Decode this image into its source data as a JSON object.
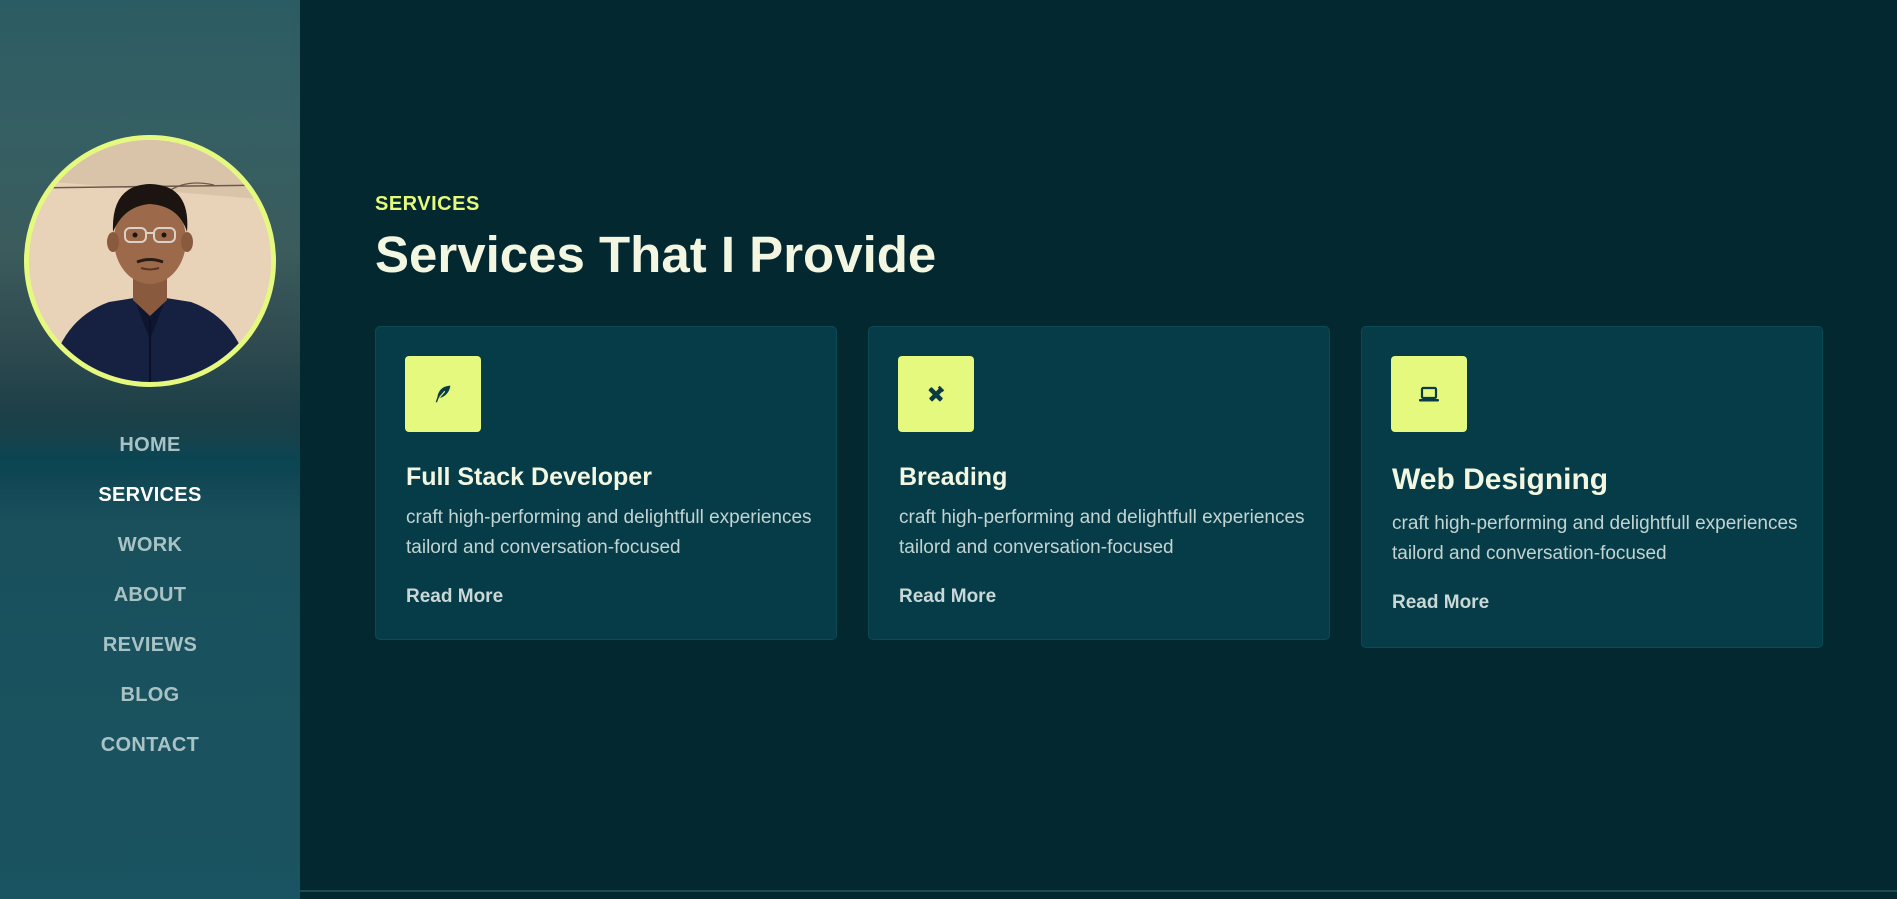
{
  "sidebar": {
    "avatar_alt": "profile photo",
    "nav": [
      {
        "label": "HOME",
        "active": false
      },
      {
        "label": "SERVICES",
        "active": true
      },
      {
        "label": "WORK",
        "active": false
      },
      {
        "label": "ABOUT",
        "active": false
      },
      {
        "label": "REVIEWS",
        "active": false
      },
      {
        "label": "BLOG",
        "active": false
      },
      {
        "label": "CONTACT",
        "active": false
      }
    ]
  },
  "services": {
    "eyebrow": "SERVICES",
    "title": "Services That I Provide",
    "cards": [
      {
        "icon": "feather-icon",
        "title": "Full Stack Developer",
        "description": "craft high-performing and delightfull experiences tailord and conversation-focused",
        "link": "Read More"
      },
      {
        "icon": "pen-ruler-icon",
        "title": "Breading",
        "description": "craft high-performing and delightfull experiences tailord and conversation-focused",
        "link": "Read More"
      },
      {
        "icon": "laptop-icon",
        "title": "Web Designing",
        "description": "craft high-performing and delightfull experiences tailord and conversation-focused",
        "link": "Read More"
      }
    ]
  },
  "colors": {
    "accent": "#e4f97d",
    "background": "#03282f",
    "card": "#053c48",
    "heading": "#f3f6e1"
  }
}
